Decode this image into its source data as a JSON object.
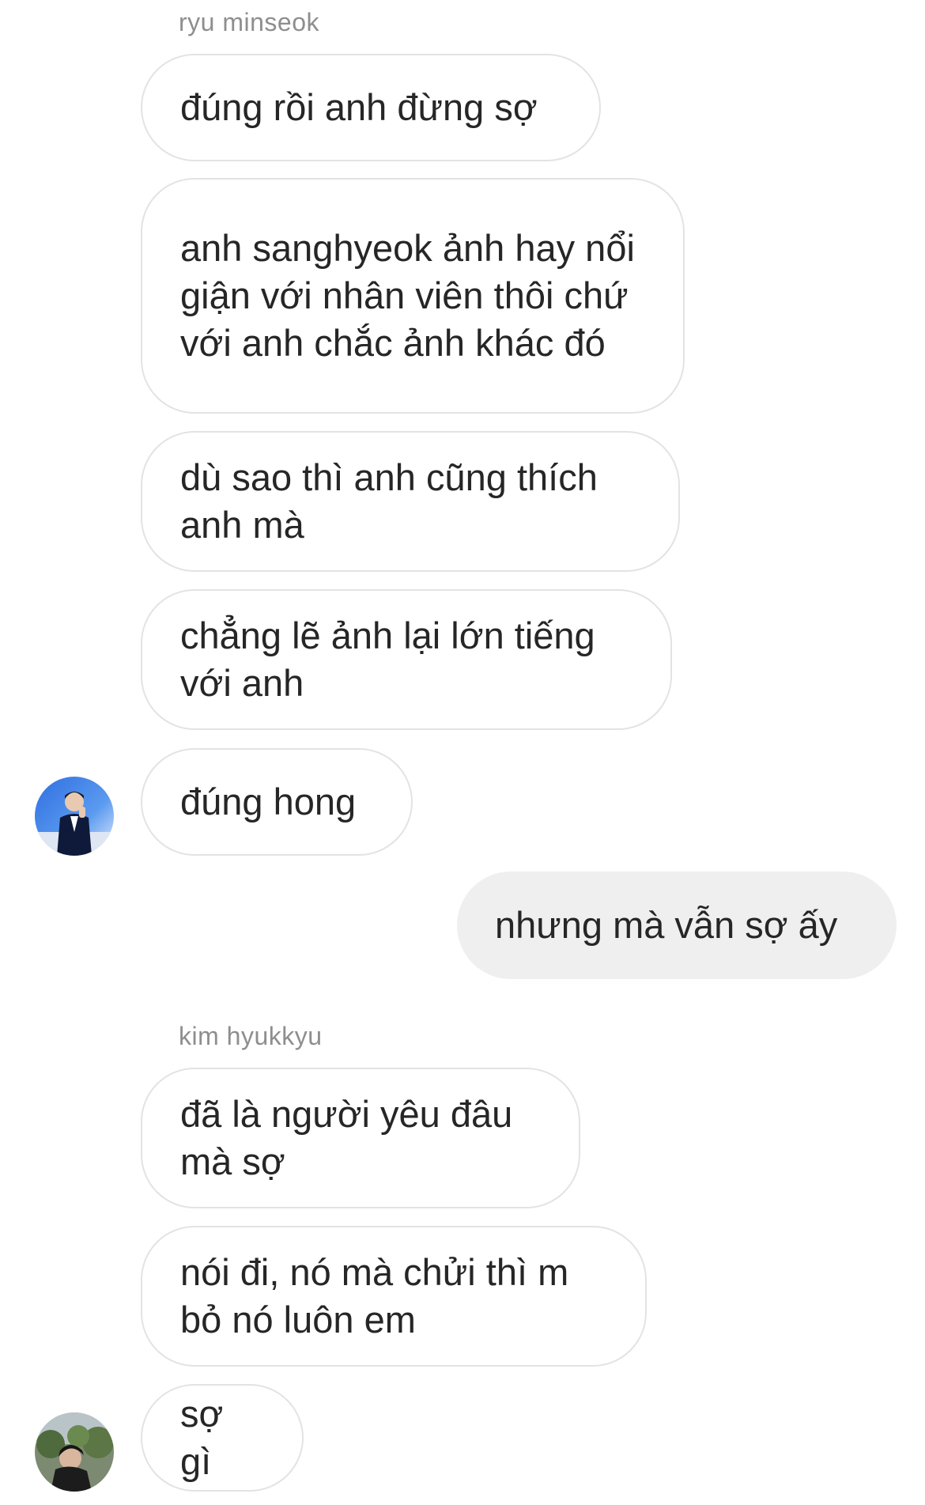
{
  "groups": [
    {
      "sender": "ryu minseok",
      "messages": [
        "đúng rồi anh đừng sợ",
        "anh sanghyeok ảnh hay nổi giận với nhân viên thôi chứ với anh chắc ảnh khác đó",
        "dù sao thì anh cũng thích anh mà",
        "chẳng lẽ ảnh lại lớn tiếng với anh",
        "đúng hong"
      ],
      "avatar_icon": "user-avatar-icon"
    },
    {
      "outgoing": [
        "nhưng mà vẫn sợ ấy"
      ]
    },
    {
      "sender": "kim hyukkyu",
      "messages": [
        "đã là người yêu đâu mà sợ",
        "nói đi, nó mà chửi thì m bỏ nó luôn em",
        "sợ gì"
      ],
      "avatar_icon": "user-avatar-icon"
    }
  ],
  "colors": {
    "incoming_bubble_border": "#e3e3e3",
    "outgoing_bubble_bg": "#efefef",
    "sender_label": "#8e8e8e",
    "text": "#262626"
  }
}
